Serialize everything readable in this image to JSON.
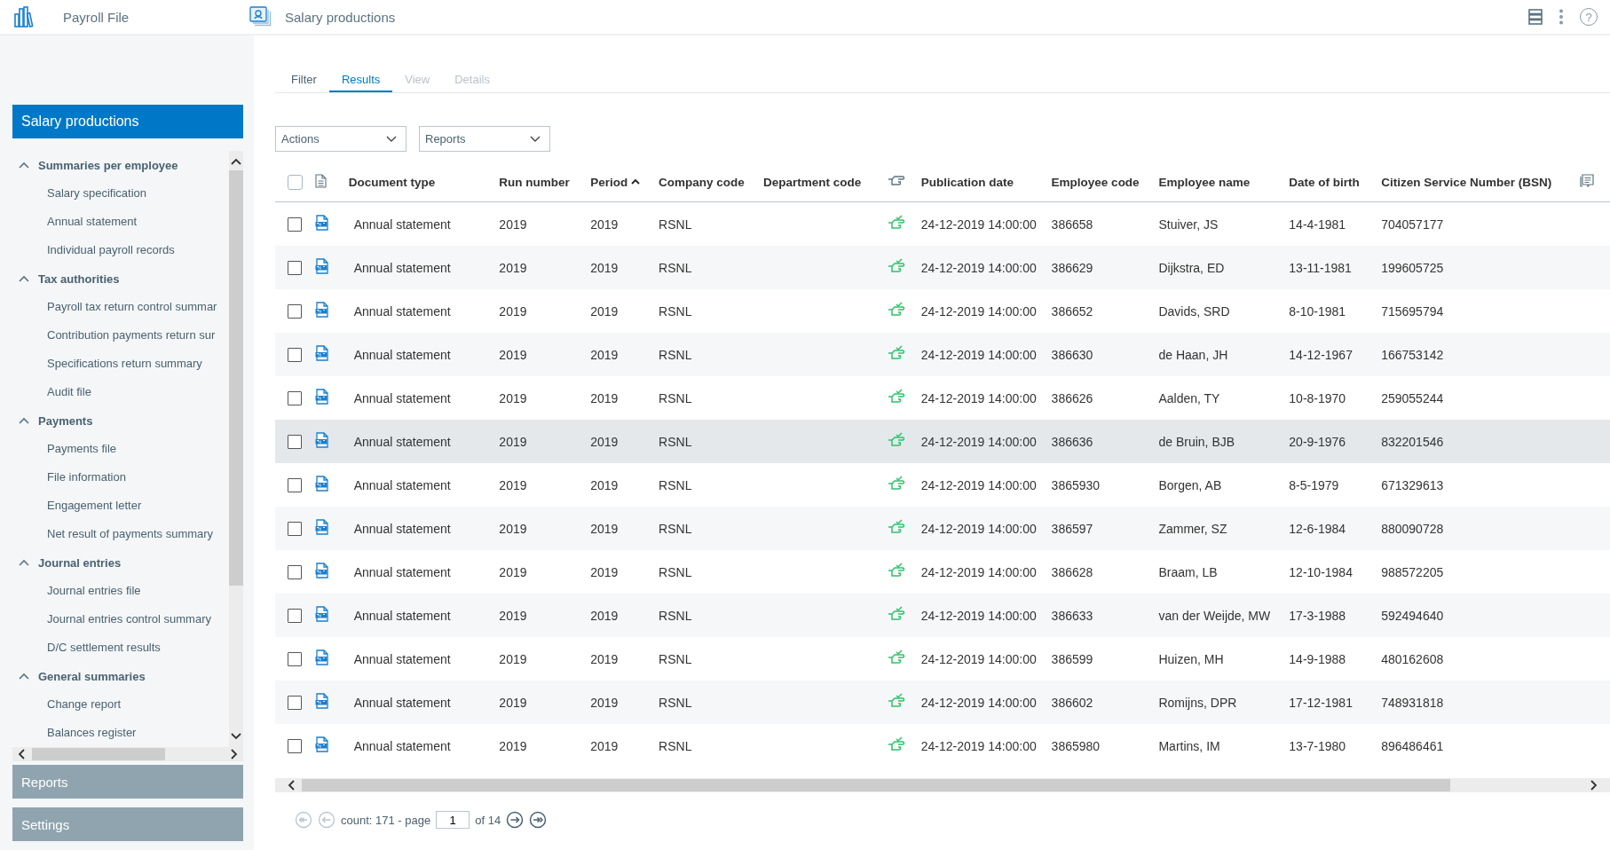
{
  "app": {
    "title": "Payroll File",
    "page_title": "Salary productions",
    "help_label": "?"
  },
  "sidebar": {
    "header": "Salary productions",
    "groups": [
      {
        "label": "Summaries per employee",
        "expanded": true,
        "children": [
          {
            "label": "Salary specification"
          },
          {
            "label": "Annual statement"
          },
          {
            "label": "Individual payroll records"
          }
        ]
      },
      {
        "label": "Tax authorities",
        "expanded": true,
        "children": [
          {
            "label": "Payroll tax return control summar"
          },
          {
            "label": "Contribution payments return sur"
          },
          {
            "label": "Specifications return summary"
          },
          {
            "label": "Audit file"
          }
        ]
      },
      {
        "label": "Payments",
        "expanded": true,
        "children": [
          {
            "label": "Payments file"
          },
          {
            "label": "File information"
          },
          {
            "label": "Engagement letter"
          },
          {
            "label": "Net result of payments summary"
          }
        ]
      },
      {
        "label": "Journal entries",
        "expanded": true,
        "children": [
          {
            "label": "Journal entries file"
          },
          {
            "label": "Journal entries control summary"
          },
          {
            "label": "D/C settlement results"
          }
        ]
      },
      {
        "label": "General summaries",
        "expanded": true,
        "children": [
          {
            "label": "Change report"
          },
          {
            "label": "Balances register"
          }
        ]
      }
    ],
    "sections": [
      {
        "label": "Reports"
      },
      {
        "label": "Settings"
      }
    ]
  },
  "tabs": [
    {
      "label": "Filter",
      "selected": false,
      "disabled": false
    },
    {
      "label": "Results",
      "selected": true,
      "disabled": false
    },
    {
      "label": "View",
      "selected": false,
      "disabled": true
    },
    {
      "label": "Details",
      "selected": false,
      "disabled": true
    }
  ],
  "dropdowns": [
    {
      "label": "Actions"
    },
    {
      "label": "Reports"
    }
  ],
  "table": {
    "select_all_checked": false,
    "columns": [
      {
        "label": "Document type",
        "sorted": false
      },
      {
        "label": "Run number",
        "sorted": false
      },
      {
        "label": "Period",
        "sorted": true
      },
      {
        "label": "Company code",
        "sorted": false
      },
      {
        "label": "Department code",
        "sorted": false
      },
      {
        "label": "Publication date",
        "sorted": false
      },
      {
        "label": "Employee code",
        "sorted": false
      },
      {
        "label": "Employee name",
        "sorted": false
      },
      {
        "label": "Date of birth",
        "sorted": false
      },
      {
        "label": "Citizen Service Number (BSN)",
        "sorted": false
      }
    ],
    "rows": [
      {
        "checked": false,
        "hovered": false,
        "published": true,
        "cells": [
          "Annual statement",
          "2019",
          "2019",
          "RSNL",
          "",
          "24-12-2019 14:00:00",
          "386658",
          "Stuiver, JS",
          "14-4-1981",
          "704057177"
        ]
      },
      {
        "checked": false,
        "hovered": false,
        "published": true,
        "cells": [
          "Annual statement",
          "2019",
          "2019",
          "RSNL",
          "",
          "24-12-2019 14:00:00",
          "386629",
          "Dijkstra, ED",
          "13-11-1981",
          "199605725"
        ]
      },
      {
        "checked": false,
        "hovered": false,
        "published": true,
        "cells": [
          "Annual statement",
          "2019",
          "2019",
          "RSNL",
          "",
          "24-12-2019 14:00:00",
          "386652",
          "Davids, SRD",
          "8-10-1981",
          "715695794"
        ]
      },
      {
        "checked": false,
        "hovered": false,
        "published": true,
        "cells": [
          "Annual statement",
          "2019",
          "2019",
          "RSNL",
          "",
          "24-12-2019 14:00:00",
          "386630",
          "de Haan, JH",
          "14-12-1967",
          "166753142"
        ]
      },
      {
        "checked": false,
        "hovered": false,
        "published": true,
        "cells": [
          "Annual statement",
          "2019",
          "2019",
          "RSNL",
          "",
          "24-12-2019 14:00:00",
          "386626",
          "Aalden, TY",
          "10-8-1970",
          "259055244"
        ]
      },
      {
        "checked": false,
        "hovered": true,
        "published": true,
        "cells": [
          "Annual statement",
          "2019",
          "2019",
          "RSNL",
          "",
          "24-12-2019 14:00:00",
          "386636",
          "de Bruin, BJB",
          "20-9-1976",
          "832201546"
        ]
      },
      {
        "checked": false,
        "hovered": false,
        "published": true,
        "cells": [
          "Annual statement",
          "2019",
          "2019",
          "RSNL",
          "",
          "24-12-2019 14:00:00",
          "3865930",
          "Borgen, AB",
          "8-5-1979",
          "671329613"
        ]
      },
      {
        "checked": false,
        "hovered": false,
        "published": true,
        "cells": [
          "Annual statement",
          "2019",
          "2019",
          "RSNL",
          "",
          "24-12-2019 14:00:00",
          "386597",
          "Zammer, SZ",
          "12-6-1984",
          "880090728"
        ]
      },
      {
        "checked": false,
        "hovered": false,
        "published": true,
        "cells": [
          "Annual statement",
          "2019",
          "2019",
          "RSNL",
          "",
          "24-12-2019 14:00:00",
          "386628",
          "Braam, LB",
          "12-10-1984",
          "988572205"
        ]
      },
      {
        "checked": false,
        "hovered": false,
        "published": true,
        "cells": [
          "Annual statement",
          "2019",
          "2019",
          "RSNL",
          "",
          "24-12-2019 14:00:00",
          "386633",
          "van der Weijde, MW",
          "17-3-1988",
          "592494640"
        ]
      },
      {
        "checked": false,
        "hovered": false,
        "published": true,
        "cells": [
          "Annual statement",
          "2019",
          "2019",
          "RSNL",
          "",
          "24-12-2019 14:00:00",
          "386599",
          "Huizen, MH",
          "14-9-1988",
          "480162608"
        ]
      },
      {
        "checked": false,
        "hovered": false,
        "published": true,
        "cells": [
          "Annual statement",
          "2019",
          "2019",
          "RSNL",
          "",
          "24-12-2019 14:00:00",
          "386602",
          "Romijns, DPR",
          "17-12-1981",
          "748931818"
        ]
      },
      {
        "checked": false,
        "hovered": false,
        "published": true,
        "cells": [
          "Annual statement",
          "2019",
          "2019",
          "RSNL",
          "",
          "24-12-2019 14:00:00",
          "3865980",
          "Martins, IM",
          "13-7-1980",
          "896486461"
        ]
      }
    ]
  },
  "pagination": {
    "summary": "count: 171 - page",
    "page": "1",
    "total": "of 14",
    "first_disabled": true,
    "prev_disabled": true
  }
}
